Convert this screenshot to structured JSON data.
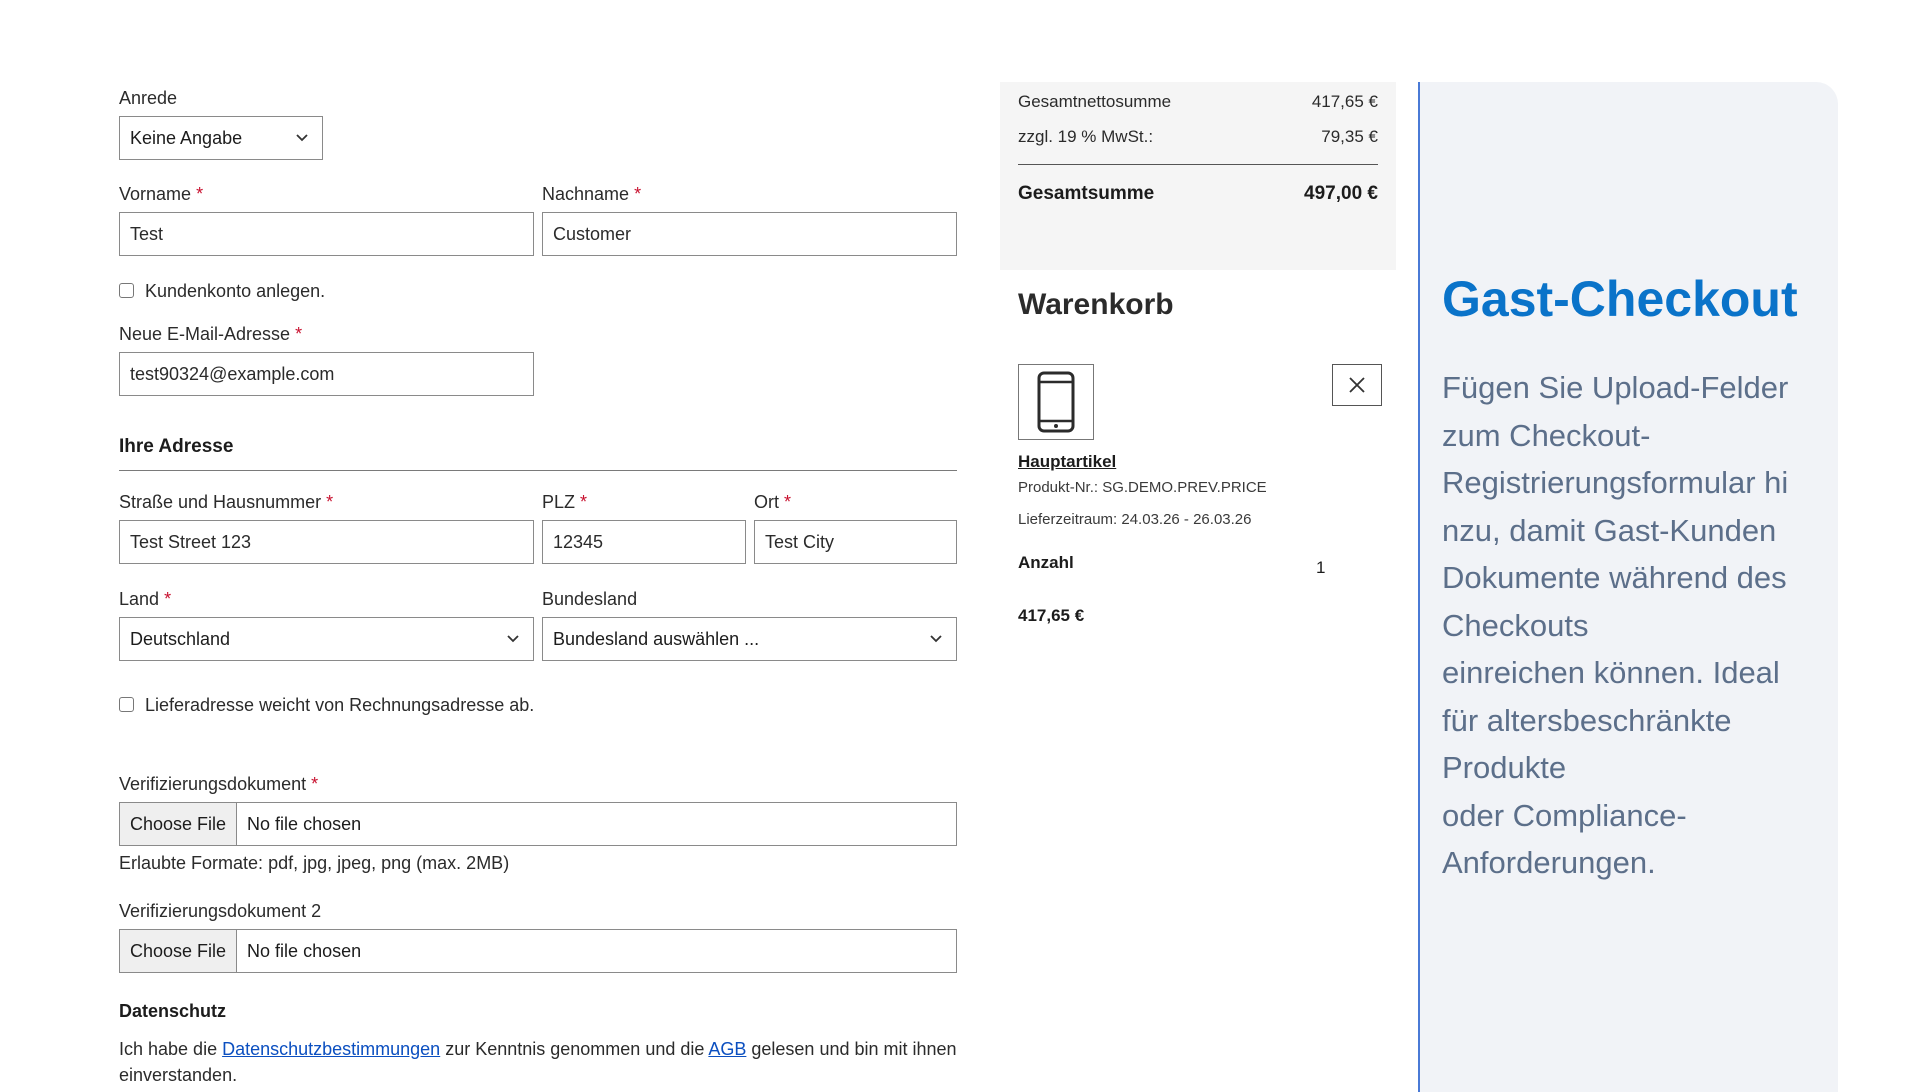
{
  "form": {
    "salutation": {
      "label": "Anrede",
      "value": "Keine Angabe"
    },
    "first_name": {
      "label": "Vorname",
      "required": "*",
      "value": "Test"
    },
    "last_name": {
      "label": "Nachname",
      "required": "*",
      "value": "Customer"
    },
    "create_account": {
      "label": "Kundenkonto anlegen."
    },
    "email": {
      "label": "Neue E-Mail-Adresse",
      "required": "*",
      "value": "test90324@example.com"
    },
    "address_heading": "Ihre Adresse",
    "street": {
      "label": "Straße und Hausnummer",
      "required": "*",
      "value": "Test Street 123"
    },
    "zip": {
      "label": "PLZ",
      "required": "*",
      "value": "12345"
    },
    "city": {
      "label": "Ort",
      "required": "*",
      "value": "Test City"
    },
    "country": {
      "label": "Land",
      "required": "*",
      "value": "Deutschland"
    },
    "state": {
      "label": "Bundesland",
      "value": "Bundesland auswählen ..."
    },
    "different_shipping": {
      "label": "Lieferadresse weicht von Rechnungsadresse ab."
    },
    "doc1": {
      "label": "Verifizierungsdokument",
      "required": "*",
      "button": "Choose File",
      "status": "No file chosen",
      "hint": "Erlaubte Formate: pdf, jpg, jpeg, png (max. 2MB)"
    },
    "doc2": {
      "label": "Verifizierungsdokument 2",
      "button": "Choose File",
      "status": "No file chosen"
    },
    "privacy": {
      "heading": "Datenschutz",
      "text_1": "Ich habe die ",
      "link_1": "Datenschutzbestimmungen",
      "text_2": " zur Kenntnis genommen und die ",
      "link_2": "AGB",
      "text_3": " gelesen und bin mit ihnen einverstanden."
    }
  },
  "summary": {
    "net_label": "Gesamtnettosumme",
    "net_value": "417,65 €",
    "tax_label": "zzgl. 19 % MwSt.:",
    "tax_value": "79,35 €",
    "total_label": "Gesamtsumme",
    "total_value": "497,00 €"
  },
  "cart": {
    "title": "Warenkorb",
    "item": {
      "name": "Hauptartikel",
      "product_no": "Produkt-Nr.: SG.DEMO.PREV.PRICE",
      "delivery": "Lieferzeitraum: 24.03.26 - 26.03.26",
      "qty_label": "Anzahl",
      "qty_value": "1",
      "price": "417,65 €"
    }
  },
  "promo": {
    "title": "Gast-Checkout",
    "lines": [
      "Fügen Sie Upload-Felder",
      "zum Checkout-",
      "Registrierungsformular hi",
      "nzu, damit Gast-Kunden",
      "Dokumente während des",
      "Checkouts",
      "einreichen können. Ideal",
      "für altersbeschränkte",
      "Produkte",
      "oder Compliance-",
      "Anforderungen."
    ]
  },
  "colors": {
    "accent": "#0a73c9",
    "promo_text": "#5c6f8a",
    "link": "#0b4fc0",
    "required": "#c8102e"
  }
}
